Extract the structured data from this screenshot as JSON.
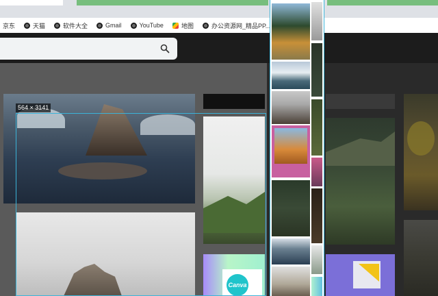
{
  "browser": {
    "bookmarks": [
      {
        "label": "京东",
        "icon": "none"
      },
      {
        "label": "天猫",
        "icon": "globe-icon"
      },
      {
        "label": "软件大全",
        "icon": "globe-icon"
      },
      {
        "label": "Gmail",
        "icon": "globe-icon"
      },
      {
        "label": "YouTube",
        "icon": "globe-icon"
      },
      {
        "label": "地图",
        "icon": "maps-icon"
      },
      {
        "label": "办公资源网_精品PP...",
        "icon": "globe-icon"
      }
    ]
  },
  "overlay": {
    "dimension_label": "564 × 3141"
  },
  "content": {
    "canva_text": "Canva"
  },
  "colors": {
    "selection_border": "#3bb3d8",
    "header_dark": "#1c1c1c",
    "bookmarks_bg": "#ffffff"
  }
}
